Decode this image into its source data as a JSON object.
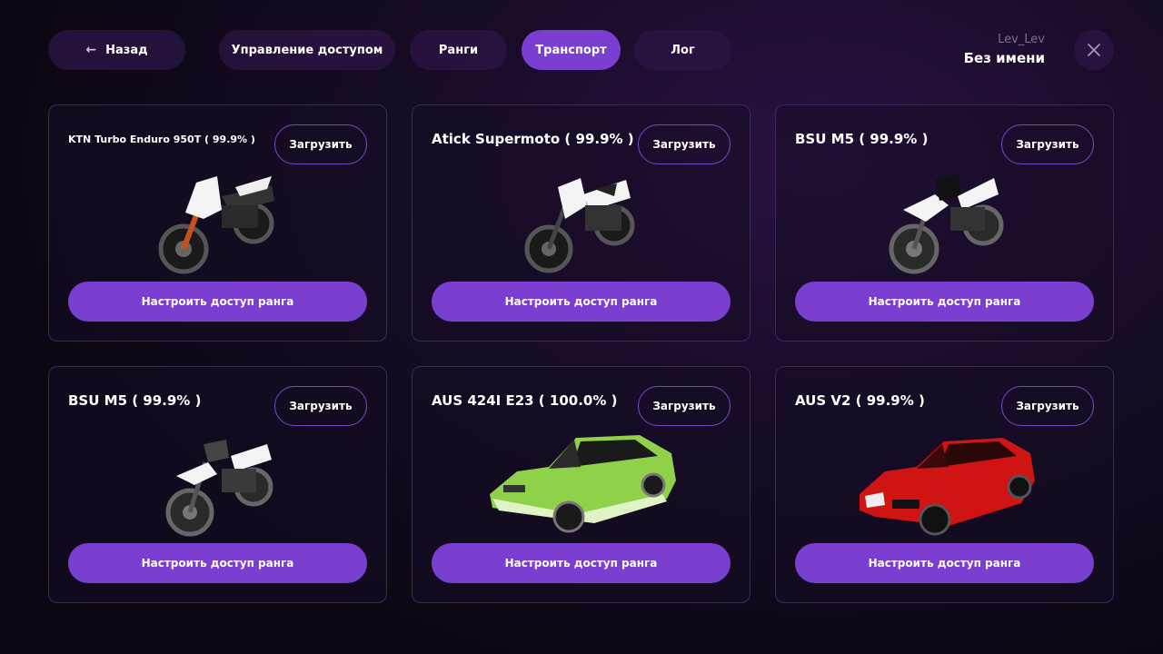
{
  "header": {
    "back_label": "Назад",
    "tabs": [
      {
        "label": "Управление доступом",
        "active": false
      },
      {
        "label": "Ранги",
        "active": false
      },
      {
        "label": "Транспорт",
        "active": true
      },
      {
        "label": "Лог",
        "active": false
      }
    ],
    "user_nick": "Lev_Lev",
    "user_name": "Без имени",
    "close_icon": "close-icon"
  },
  "load_label": "Загрузить",
  "rank_access_label": "Настроить доступ ранга",
  "vehicles": [
    {
      "title": "KTN Turbo Enduro 950T ( 99.9% )",
      "kind": "motorcycle",
      "accent": "#c8501a"
    },
    {
      "title": "Atick Supermoto ( 99.9% )",
      "kind": "motorcycle",
      "accent": "#444444"
    },
    {
      "title": "BSU M5 ( 99.9% )",
      "kind": "motorcycle",
      "accent": "#222222"
    },
    {
      "title": "BSU M5 ( 99.9% )",
      "kind": "motorcycle",
      "accent": "#555555"
    },
    {
      "title": "AUS 424I E23 ( 100.0% )",
      "kind": "sedan",
      "accent": "#8fd24a"
    },
    {
      "title": "AUS V2 ( 99.9% )",
      "kind": "coupe",
      "accent": "#d01414"
    }
  ],
  "colors": {
    "accent": "#7a3fd0",
    "card_border": "#3e2470"
  }
}
